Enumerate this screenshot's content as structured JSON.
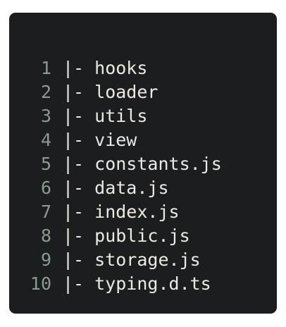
{
  "code_block": {
    "lines": [
      {
        "number": "1",
        "text": "|- hooks"
      },
      {
        "number": "2",
        "text": "|- loader"
      },
      {
        "number": "3",
        "text": "|- utils"
      },
      {
        "number": "4",
        "text": "|- view"
      },
      {
        "number": "5",
        "text": "|- constants.js"
      },
      {
        "number": "6",
        "text": "|- data.js"
      },
      {
        "number": "7",
        "text": "|- index.js"
      },
      {
        "number": "8",
        "text": "|- public.js"
      },
      {
        "number": "9",
        "text": "|- storage.js"
      },
      {
        "number": "10",
        "text": "|- typing.d.ts"
      }
    ]
  },
  "colors": {
    "background": "#1c1d1e",
    "line_number": "#8a9b8f",
    "text": "#ece9e2"
  }
}
